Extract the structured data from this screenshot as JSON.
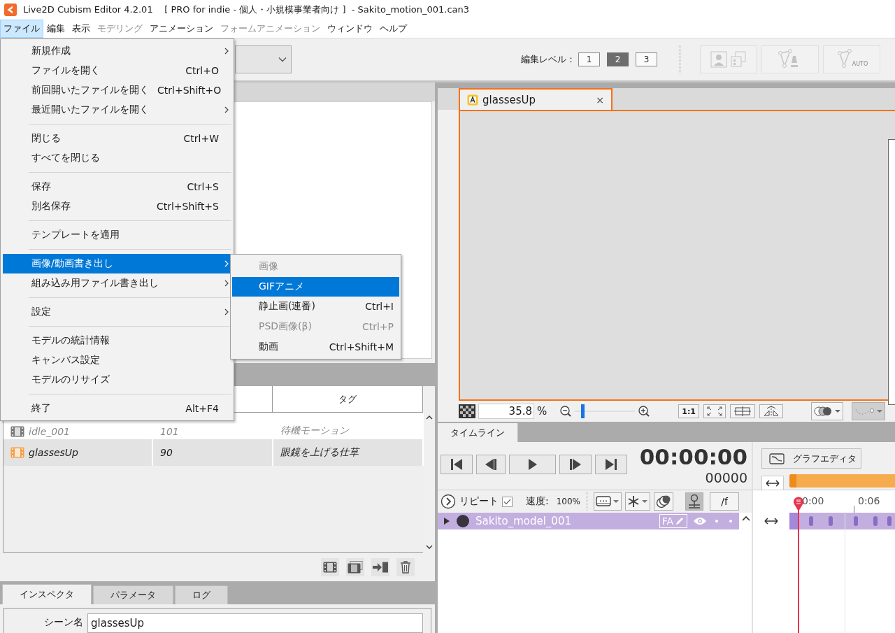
{
  "window": {
    "title": "Live2D Cubism Editor 4.2.01    [ PRO for indie - 個人・小規模事業者向け ]  - Sakito_motion_001.can3"
  },
  "menu_bar": [
    {
      "label": "ファイル",
      "selected": true,
      "disabled": false
    },
    {
      "label": "編集",
      "selected": false,
      "disabled": false
    },
    {
      "label": "表示",
      "selected": false,
      "disabled": false
    },
    {
      "label": "モデリング",
      "selected": false,
      "disabled": true
    },
    {
      "label": "アニメーション",
      "selected": false,
      "disabled": false
    },
    {
      "label": "フォームアニメーション",
      "selected": false,
      "disabled": true
    },
    {
      "label": "ウィンドウ",
      "selected": false,
      "disabled": false
    },
    {
      "label": "ヘルプ",
      "selected": false,
      "disabled": false
    }
  ],
  "file_menu": [
    {
      "kind": "item",
      "label": "新規作成",
      "submenu": true,
      "selected": false
    },
    {
      "kind": "item",
      "label": "ファイルを開く",
      "shortcut": "Ctrl+O",
      "submenu": false,
      "selected": false
    },
    {
      "kind": "item",
      "label": "前回開いたファイルを開く",
      "shortcut": "Ctrl+Shift+O",
      "submenu": false,
      "selected": false
    },
    {
      "kind": "item",
      "label": "最近開いたファイルを開く",
      "submenu": true,
      "selected": false
    },
    {
      "kind": "separator"
    },
    {
      "kind": "item",
      "label": "閉じる",
      "shortcut": "Ctrl+W",
      "submenu": false,
      "selected": false
    },
    {
      "kind": "item",
      "label": "すべてを閉じる",
      "submenu": false,
      "selected": false
    },
    {
      "kind": "separator"
    },
    {
      "kind": "item",
      "label": "保存",
      "shortcut": "Ctrl+S",
      "submenu": false,
      "selected": false
    },
    {
      "kind": "item",
      "label": "別名保存",
      "shortcut": "Ctrl+Shift+S",
      "submenu": false,
      "selected": false
    },
    {
      "kind": "separator"
    },
    {
      "kind": "item",
      "label": "テンプレートを適用",
      "submenu": false,
      "selected": false
    },
    {
      "kind": "separator"
    },
    {
      "kind": "item",
      "label": "画像/動画書き出し",
      "submenu": true,
      "selected": true
    },
    {
      "kind": "item",
      "label": "組み込み用ファイル書き出し",
      "submenu": true,
      "selected": false
    },
    {
      "kind": "separator"
    },
    {
      "kind": "item",
      "label": "設定",
      "submenu": true,
      "selected": false
    },
    {
      "kind": "separator"
    },
    {
      "kind": "item",
      "label": "モデルの統計情報",
      "submenu": false,
      "selected": false
    },
    {
      "kind": "item",
      "label": "キャンバス設定",
      "submenu": false,
      "selected": false
    },
    {
      "kind": "item",
      "label": "モデルのリサイズ",
      "submenu": false,
      "selected": false
    },
    {
      "kind": "separator"
    },
    {
      "kind": "item",
      "label": "終了",
      "shortcut": "Alt+F4",
      "submenu": false,
      "selected": false
    }
  ],
  "export_submenu": [
    {
      "label": "画像",
      "selected": false,
      "disabled": true
    },
    {
      "label": "GIFアニメ",
      "selected": true,
      "disabled": false
    },
    {
      "label": "静止画(連番)",
      "shortcut": "Ctrl+I",
      "selected": false,
      "disabled": false
    },
    {
      "label": "PSD画像(β)",
      "shortcut": "Ctrl+P",
      "selected": false,
      "disabled": true
    },
    {
      "label": "動画",
      "shortcut": "Ctrl+Shift+M",
      "selected": false,
      "disabled": false
    }
  ],
  "toolbar": {
    "edit_level_label": "編集レベル：",
    "edit_levels": [
      {
        "label": "1",
        "selected": false
      },
      {
        "label": "2",
        "selected": true
      },
      {
        "label": "3",
        "selected": false
      }
    ],
    "auto_label": "AUTO"
  },
  "motion_list": {
    "tag_header": "タグ",
    "rows": [
      {
        "name": "idle_001",
        "column_2": "101",
        "tag": "待機モーション",
        "selected": false,
        "disabled": true
      },
      {
        "name": "glassesUp",
        "column_2": "90",
        "tag": "眼鏡を上げる仕草",
        "selected": true,
        "disabled": false
      }
    ]
  },
  "inspector": {
    "tabs": [
      {
        "label": "インスペクタ",
        "selected": true
      },
      {
        "label": "パラメータ",
        "selected": false
      },
      {
        "label": "ログ",
        "selected": false
      }
    ],
    "scene_name_label": "シーン名",
    "scene_name": "glassesUp"
  },
  "canvas": {
    "tab_title": "glassesUp",
    "close": "×",
    "zoom_value": "35.8",
    "zoom_unit": "%",
    "zoom": {
      "level": 0.13
    },
    "actual_size": "1:1"
  },
  "timeline": {
    "tab": "タイムライン",
    "time": "00:00:00",
    "frame": "00000",
    "repeat_label": "リピート",
    "repeat": true,
    "speed_label": "速度:",
    "speed": "100%",
    "per_frame": "/f",
    "track": {
      "name": "Sakito_model_001",
      "badge": "FA"
    },
    "graph_editor": "グラフエディタ",
    "ruler": [
      "0:00",
      "0:06"
    ]
  }
}
